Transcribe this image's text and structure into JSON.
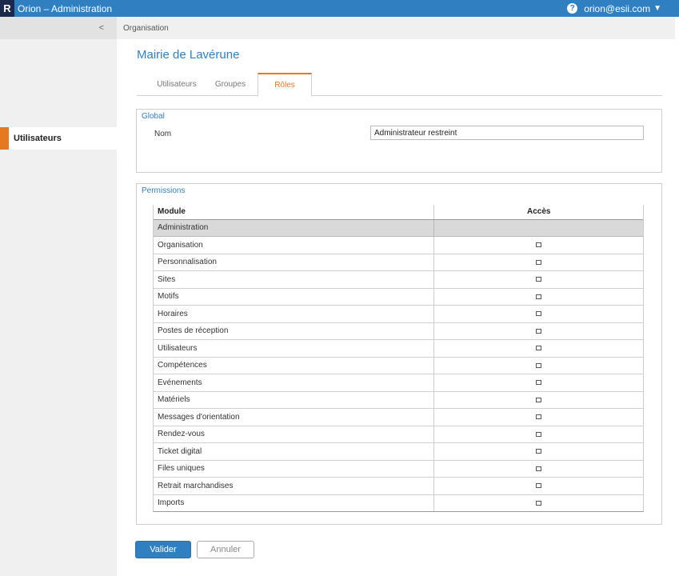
{
  "topbar": {
    "logo": "R",
    "title": "Orion – Administration",
    "help_icon": "?",
    "user": "orion@esii.com",
    "caret_icon": "▼"
  },
  "sidebar": {
    "collapse_label": "<",
    "items": [
      {
        "label": "Utilisateurs",
        "active": true
      }
    ]
  },
  "breadcrumb": "Organisation",
  "page_title": "Mairie de Lavérune",
  "tabs": [
    {
      "label": "Utilisateurs",
      "active": false
    },
    {
      "label": "Groupes",
      "active": false
    },
    {
      "label": "Rôles",
      "active": true
    }
  ],
  "global": {
    "legend": "Global",
    "nom_label": "Nom",
    "nom_value": "Administrateur restreint"
  },
  "permissions": {
    "legend": "Permissions",
    "col_module": "Module",
    "col_acces": "Accès",
    "group": "Administration",
    "rows": [
      {
        "module": "Organisation",
        "checked": false
      },
      {
        "module": "Personnalisation",
        "checked": false
      },
      {
        "module": "Sites",
        "checked": false
      },
      {
        "module": "Motifs",
        "checked": false
      },
      {
        "module": "Horaires",
        "checked": false
      },
      {
        "module": "Postes de réception",
        "checked": false
      },
      {
        "module": "Utilisateurs",
        "checked": false
      },
      {
        "module": "Compétences",
        "checked": false
      },
      {
        "module": "Evénements",
        "checked": false
      },
      {
        "module": "Matériels",
        "checked": false
      },
      {
        "module": "Messages d'orientation",
        "checked": false
      },
      {
        "module": "Rendez-vous",
        "checked": false
      },
      {
        "module": "Ticket digital",
        "checked": false
      },
      {
        "module": "Files uniques",
        "checked": false
      },
      {
        "module": "Retrait marchandises",
        "checked": false
      },
      {
        "module": "Imports",
        "checked": false
      }
    ]
  },
  "buttons": {
    "validate": "Valider",
    "cancel": "Annuler"
  },
  "colors": {
    "accent": "#2f7fc1",
    "active_tab": "#e87722",
    "sidebar_marker": "#e87722"
  }
}
